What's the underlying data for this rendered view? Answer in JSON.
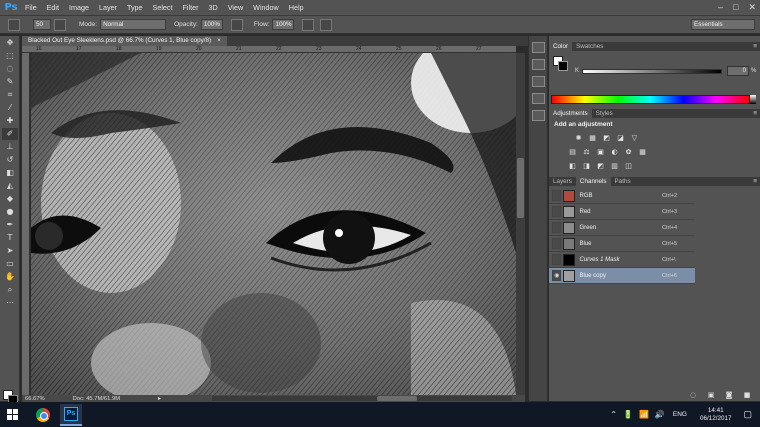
{
  "app": {
    "logo": "Ps"
  },
  "menu": [
    "File",
    "Edit",
    "Image",
    "Layer",
    "Type",
    "Select",
    "Filter",
    "3D",
    "View",
    "Window",
    "Help"
  ],
  "window_controls": {
    "minimize": "–",
    "maximize": "□",
    "close": "✕"
  },
  "options": {
    "brush_size": "50",
    "mode_label": "Mode:",
    "mode_value": "Normal",
    "opacity_label": "Opacity:",
    "opacity_value": "100%",
    "flow_label": "Flow:",
    "flow_value": "100%",
    "workspace": "Essentials"
  },
  "document": {
    "tab_title": "Blacked Out Eye Sleeklens.psd @ 66.7% (Curves 1, Blue copy/8)",
    "tab_close": "×",
    "ruler_ticks": [
      "16",
      "17",
      "18",
      "19",
      "20",
      "21",
      "22",
      "23",
      "24",
      "25",
      "26",
      "27"
    ]
  },
  "status": {
    "zoom": "66.67%",
    "doc": "Doc: 45.7M/61.9M",
    "arrow": "▸"
  },
  "color_panel": {
    "tabs": [
      "Color",
      "Swatches"
    ],
    "channel_label": "K",
    "value": "0",
    "unit": "%"
  },
  "adjustments_panel": {
    "tabs": [
      "Adjustments",
      "Styles"
    ],
    "title": "Add an adjustment",
    "row1_icons": [
      "✺",
      "▦",
      "◩",
      "◪",
      "▽"
    ],
    "row2_icons": [
      "▤",
      "⚖",
      "▣",
      "◐",
      "✿",
      "▦"
    ],
    "row3_icons": [
      "◧",
      "◨",
      "◩",
      "▥",
      "◫"
    ]
  },
  "layers_panel": {
    "tabs": [
      "Layers",
      "Channels",
      "Paths"
    ],
    "channels": [
      {
        "name": "RGB",
        "key": "Ctrl+2",
        "visible": false,
        "selected": false,
        "thumb": "#b04a3e"
      },
      {
        "name": "Red",
        "key": "Ctrl+3",
        "visible": false,
        "selected": false,
        "thumb": "#9a9a9a"
      },
      {
        "name": "Green",
        "key": "Ctrl+4",
        "visible": false,
        "selected": false,
        "thumb": "#8c8c8c"
      },
      {
        "name": "Blue",
        "key": "Ctrl+5",
        "visible": false,
        "selected": false,
        "thumb": "#7a7a7a"
      },
      {
        "name": "Curves 1 Mask",
        "key": "Ctrl+\\",
        "visible": false,
        "selected": false,
        "thumb": "#000000"
      },
      {
        "name": "Blue copy",
        "key": "Ctrl+6",
        "visible": true,
        "selected": true,
        "thumb": "#a0a0a0"
      }
    ],
    "bottom_icons": [
      "◌",
      "▣",
      "◙",
      "■",
      "🗑"
    ]
  },
  "taskbar": {
    "time": "14:41",
    "date": "06/12/2017",
    "language": "ENG",
    "tray_icons": [
      "⌃",
      "🔋",
      "📶",
      "🔊"
    ],
    "notification": "▢"
  }
}
